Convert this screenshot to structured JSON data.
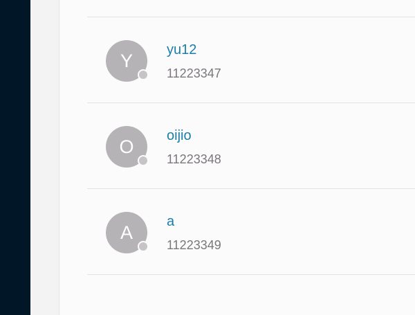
{
  "contacts": [
    {
      "initial": "Y",
      "name": "yu12",
      "number": "11223347"
    },
    {
      "initial": "O",
      "name": "oijio",
      "number": "11223348"
    },
    {
      "initial": "A",
      "name": "a",
      "number": "11223349"
    }
  ]
}
